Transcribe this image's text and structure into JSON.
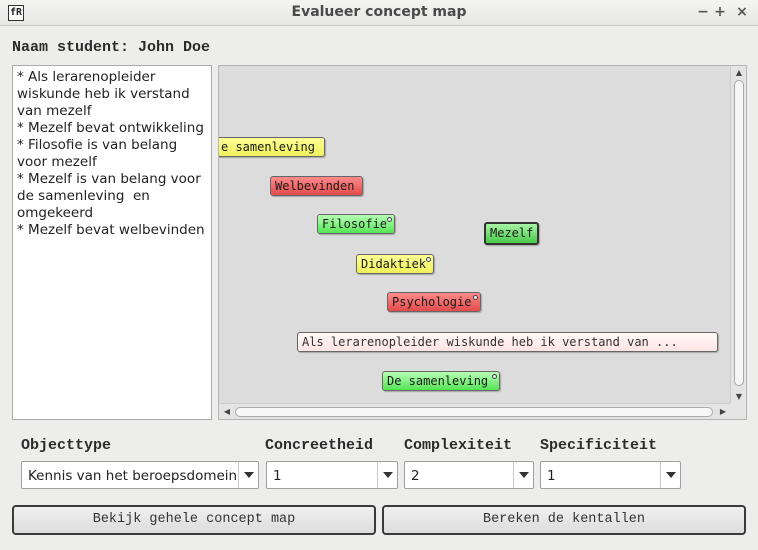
{
  "window": {
    "title": "Evalueer concept map",
    "app_icon": "fR",
    "controls": {
      "minimize": "−",
      "maximize": "+",
      "close": "×"
    }
  },
  "student": {
    "label": "Naam student: John Doe"
  },
  "statements": [
    "* Als lerarenopleider wiskunde heb ik verstand van mezelf",
    "* Mezelf bevat ontwikkeling",
    "* Filosofie is van belang voor mezelf",
    "* Mezelf is van belang voor de samenleving  en omgekeerd",
    "* Mezelf bevat welbevinden"
  ],
  "concept_map": {
    "nodes": [
      {
        "label": "e samenleving",
        "color": "yellow"
      },
      {
        "label": "Welbevinden",
        "color": "red"
      },
      {
        "label": "Filosofie",
        "color": "green"
      },
      {
        "label": "Mezelf",
        "color": "green-selected"
      },
      {
        "label": "Didaktiek",
        "color": "yellow"
      },
      {
        "label": "Psychologie",
        "color": "red"
      },
      {
        "label": "Als lerarenopleider wiskunde heb ik verstand van ...",
        "color": "pink"
      },
      {
        "label": "De samenleving",
        "color": "green"
      }
    ]
  },
  "fields": {
    "objecttype": {
      "label": "Objecttype",
      "value": "Kennis van het beroepsdomein"
    },
    "concreetheid": {
      "label": "Concreetheid",
      "value": "1"
    },
    "complexiteit": {
      "label": "Complexiteit",
      "value": "2"
    },
    "specificiteit": {
      "label": "Specificiteit",
      "value": "1"
    }
  },
  "buttons": {
    "view_map": "Bekijk gehele concept map",
    "compute": "Bereken de kentallen"
  },
  "colors": {
    "yellow": "#f5f56b",
    "red": "#ea5d5d",
    "green": "#6fef6f",
    "pink": "#ffeaea"
  }
}
